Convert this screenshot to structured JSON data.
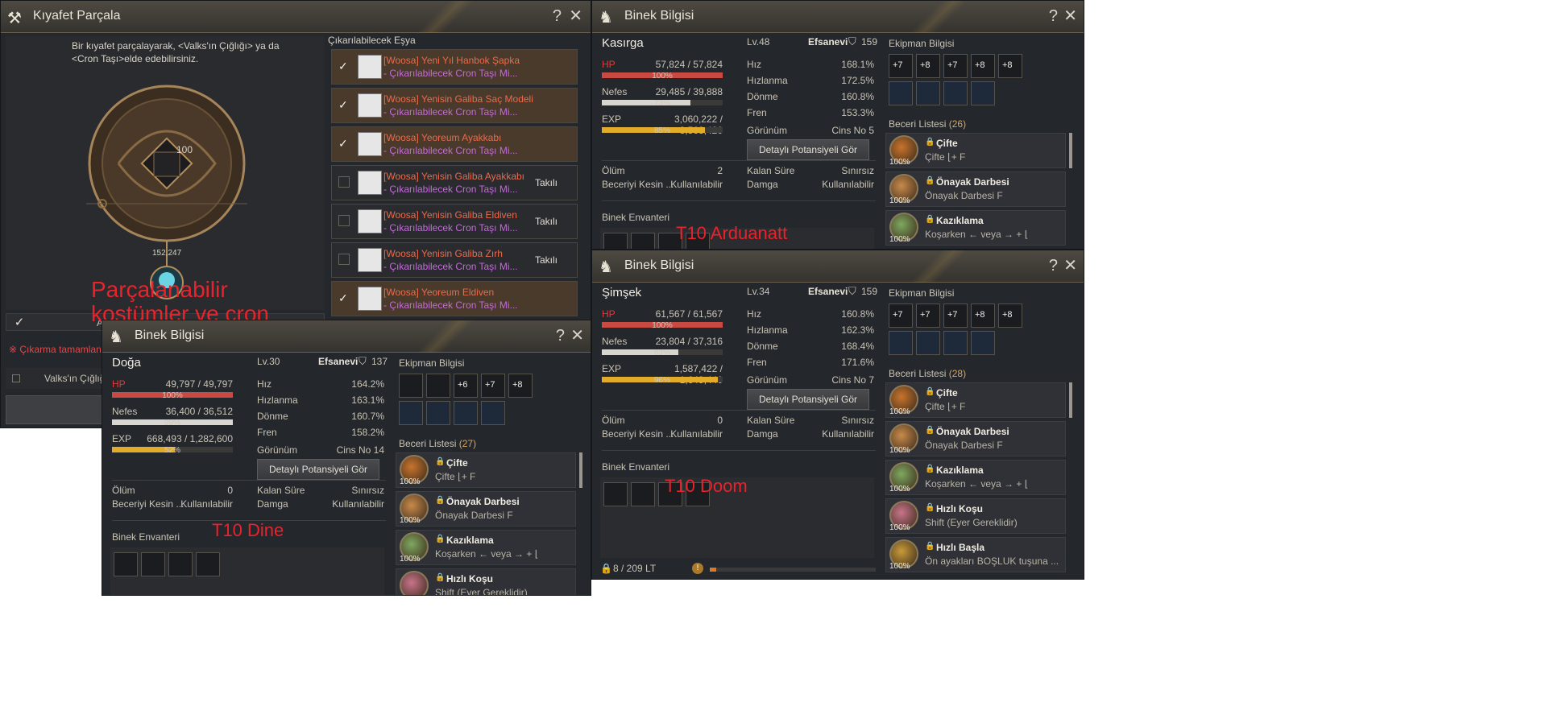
{
  "w1": {
    "title": "Kıyafet Parçala",
    "help": "?",
    "close": "✕",
    "desc": "Bir kıyafet parçalayarak, <Valks'ın Çığlığı> ya da <Cron Taşı>elde edebilirsiniz.",
    "count": "100",
    "stone_count": "152,247",
    "list_header": "Çıkarılabilecek Eşya",
    "items": [
      {
        "name": "[Woosa] Yeni Yıl Hanbok Şapka",
        "sub": "- Çıkarılabilecek Cron Taşı Mi...",
        "status": "",
        "checked": true
      },
      {
        "name": "[Woosa] Yenisin Galiba Saç Modeli",
        "sub": "- Çıkarılabilecek Cron Taşı Mi...",
        "status": "",
        "checked": true
      },
      {
        "name": "[Woosa] Yeoreum Ayakkabı",
        "sub": "- Çıkarılabilecek Cron Taşı Mi...",
        "status": "",
        "checked": true
      },
      {
        "name": "[Woosa] Yenisin Galiba Ayakkabı",
        "sub": "- Çıkarılabilecek Cron Taşı Mi...",
        "status": "Takılı",
        "checked": false
      },
      {
        "name": "[Woosa] Yenisin Galiba Eldiven",
        "sub": "- Çıkarılabilecek Cron Taşı Mi...",
        "status": "Takılı",
        "checked": false
      },
      {
        "name": "[Woosa] Yenisin Galiba Zırh",
        "sub": "- Çıkarılabilecek Cron Taşı Mi...",
        "status": "Takılı",
        "checked": false
      },
      {
        "name": "[Woosa] Yeoreum Eldiven",
        "sub": "- Çıkarılabilecek Cron Taşı Mi...",
        "status": "",
        "checked": true
      }
    ],
    "complete": "※ Çıkarma tamamlandı",
    "valks": "Valks'ın Çığlığı",
    "partial_a": "A",
    "annotation": "Parçalanabilir kostümler ve cron"
  },
  "mounts": [
    {
      "title": "Binek Bilgisi",
      "help": "?",
      "close": "✕",
      "name": "Doğa",
      "lv": "Lv.30",
      "grade": "Efsanevi",
      "shield": "137",
      "hp": "49,797 / 49,797",
      "hp_pct_label": "100%",
      "hp_pct": 1.0,
      "stamina": "36,400 / 36,512",
      "st_pct_label": "99%",
      "st_pct": 0.997,
      "exp": "668,493 / 1,282,600",
      "exp_pct_label": "52%",
      "exp_pct": 0.52,
      "stats": [
        {
          "l": "Hız",
          "v": "164.2%"
        },
        {
          "l": "Hızlanma",
          "v": "163.1%"
        },
        {
          "l": "Dönme",
          "v": "160.7%"
        },
        {
          "l": "Fren",
          "v": "158.2%"
        }
      ],
      "look_l": "Görünüm",
      "look_v": "Cins No 14",
      "potential": "Detaylı Potansiyeli Gör",
      "death_l": "Ölüm",
      "death_v": "0",
      "skillc_l": "Beceriyi Kesin ...",
      "skillc_v": "Kullanılabilir",
      "remain_l": "Kalan Süre",
      "remain_v": "Sınırsız",
      "stamp_l": "Damga",
      "stamp_v": "Kullanılabilir",
      "equip_h": "Ekipman Bilgisi",
      "skills_h": "Beceri Listesi",
      "skills_count": "(27)",
      "equip_labels": [
        "",
        "",
        "+6",
        "+7",
        "+8"
      ],
      "skills": [
        {
          "name": "Çifte",
          "key": "Çifte ⌊+ F",
          "pct": "100%",
          "color": "#c8742c"
        },
        {
          "name": "Önayak Darbesi",
          "key": "Önayak Darbesi F",
          "pct": "100%",
          "color": "#c88a4a"
        },
        {
          "name": "Kazıklama",
          "key": "Koşarken ← veya → + ⌊",
          "pct": "100%",
          "color": "#7fa860"
        },
        {
          "name": "Hızlı Koşu",
          "key": "Shift (Eyer Gereklidir)",
          "pct": "",
          "color": "#c8748a"
        }
      ],
      "inv_h": "Binek Envanteri",
      "annotation": "T10 Dine"
    },
    {
      "title": "Binek Bilgisi",
      "help": "?",
      "close": "✕",
      "name": "Kasırga",
      "lv": "Lv.48",
      "grade": "Efsanevi",
      "shield": "159",
      "hp": "57,824 / 57,824",
      "hp_pct_label": "100%",
      "hp_pct": 1.0,
      "stamina": "29,485 / 39,888",
      "st_pct_label": "73%",
      "st_pct": 0.73,
      "exp": "3,060,222 / 3,568,420",
      "exp_pct_label": "85%",
      "exp_pct": 0.85,
      "stats": [
        {
          "l": "Hız",
          "v": "168.1%"
        },
        {
          "l": "Hızlanma",
          "v": "172.5%"
        },
        {
          "l": "Dönme",
          "v": "160.8%"
        },
        {
          "l": "Fren",
          "v": "153.3%"
        }
      ],
      "look_l": "Görünüm",
      "look_v": "Cins No 5",
      "potential": "Detaylı Potansiyeli Gör",
      "death_l": "Ölüm",
      "death_v": "2",
      "skillc_l": "Beceriyi Kesin ...",
      "skillc_v": "Kullanılabilir",
      "remain_l": "Kalan Süre",
      "remain_v": "Sınırsız",
      "stamp_l": "Damga",
      "stamp_v": "Kullanılabilir",
      "equip_h": "Ekipman Bilgisi",
      "skills_h": "Beceri Listesi",
      "skills_count": "(26)",
      "equip_labels": [
        "+7",
        "+8",
        "+7",
        "+8",
        "+8"
      ],
      "skills": [
        {
          "name": "Çifte",
          "key": "Çifte ⌊+ F",
          "pct": "100%",
          "color": "#c8742c"
        },
        {
          "name": "Önayak Darbesi",
          "key": "Önayak Darbesi F",
          "pct": "100%",
          "color": "#c88a4a"
        },
        {
          "name": "Kazıklama",
          "key": "Koşarken ← veya → + ⌊",
          "pct": "100%",
          "color": "#7fa860"
        }
      ],
      "inv_h": "Binek Envanteri",
      "annotation": "T10 Arduanatt"
    },
    {
      "title": "Binek Bilgisi",
      "help": "?",
      "close": "✕",
      "name": "Şimşek",
      "lv": "Lv.34",
      "grade": "Efsanevi",
      "shield": "159",
      "hp": "61,567 / 61,567",
      "hp_pct_label": "100%",
      "hp_pct": 1.0,
      "stamina": "23,804 / 37,316",
      "st_pct_label": "63%",
      "st_pct": 0.63,
      "exp": "1,587,422 / 1,649,440",
      "exp_pct_label": "96%",
      "exp_pct": 0.96,
      "stats": [
        {
          "l": "Hız",
          "v": "160.8%"
        },
        {
          "l": "Hızlanma",
          "v": "162.3%"
        },
        {
          "l": "Dönme",
          "v": "168.4%"
        },
        {
          "l": "Fren",
          "v": "171.6%"
        }
      ],
      "look_l": "Görünüm",
      "look_v": "Cins No 7",
      "potential": "Detaylı Potansiyeli Gör",
      "death_l": "Ölüm",
      "death_v": "0",
      "skillc_l": "Beceriyi Kesin ...",
      "skillc_v": "Kullanılabilir",
      "remain_l": "Kalan Süre",
      "remain_v": "Sınırsız",
      "stamp_l": "Damga",
      "stamp_v": "Kullanılabilir",
      "equip_h": "Ekipman Bilgisi",
      "skills_h": "Beceri Listesi",
      "skills_count": "(28)",
      "equip_labels": [
        "+7",
        "+7",
        "+7",
        "+8",
        "+8"
      ],
      "skills": [
        {
          "name": "Çifte",
          "key": "Çifte ⌊+ F",
          "pct": "100%",
          "color": "#c8742c"
        },
        {
          "name": "Önayak Darbesi",
          "key": "Önayak Darbesi F",
          "pct": "100%",
          "color": "#c88a4a"
        },
        {
          "name": "Kazıklama",
          "key": "Koşarken ← veya → + ⌊",
          "pct": "100%",
          "color": "#7fa860"
        },
        {
          "name": "Hızlı Koşu",
          "key": "Shift (Eyer Gereklidir)",
          "pct": "100%",
          "color": "#c8748a"
        },
        {
          "name": "Hızlı Başla",
          "key": "Ön ayakları BOŞLUK tuşuna ...",
          "pct": "100%",
          "color": "#c89a3a"
        }
      ],
      "inv_h": "Binek Envanteri",
      "weight": "8 / 209 LT",
      "weight_pct": 0.04,
      "annotation": "T10 Doom"
    }
  ],
  "colors": {
    "hp": "#c84a42",
    "stamina": "#d8d6d0",
    "exp": "#e2ac2a",
    "item_name": "#ea6a4a",
    "item_sub": "#c36ad8"
  }
}
